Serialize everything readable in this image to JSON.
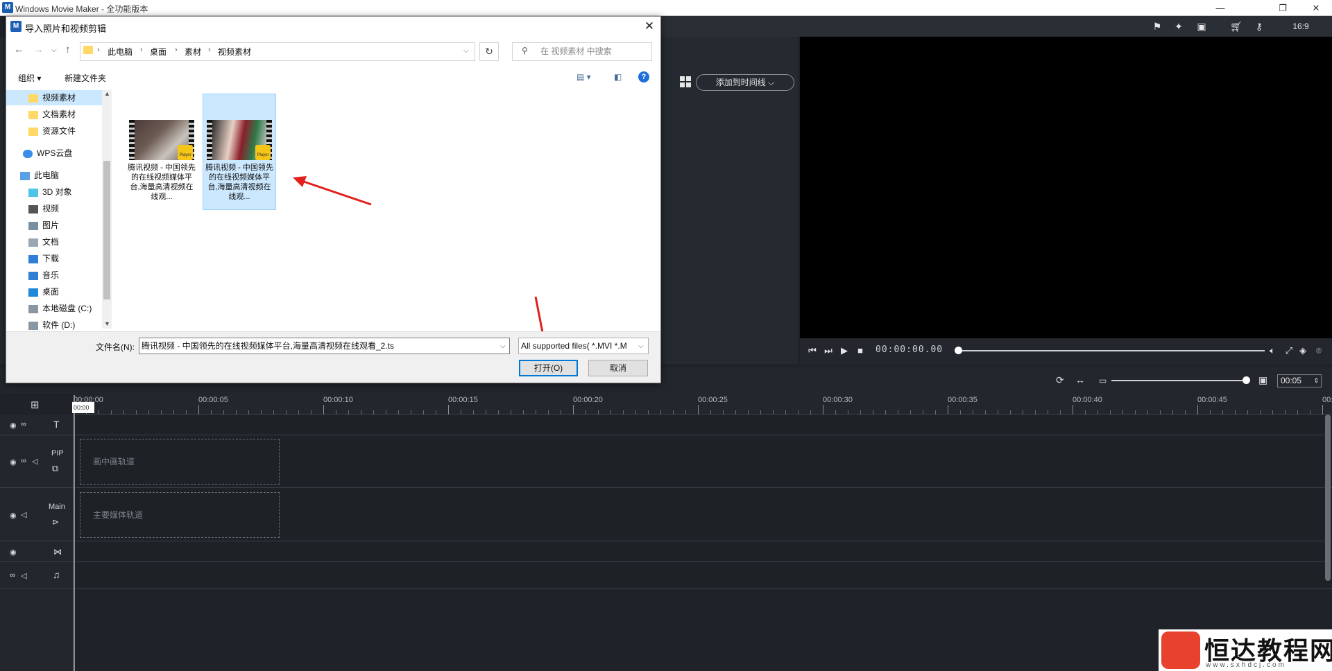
{
  "app": {
    "title": "Windows Movie Maker  - 全功能版本"
  },
  "media": {
    "add_to_timeline": "添加到时间线"
  },
  "preview": {
    "timecode": "00:00:00.00"
  },
  "timeline": {
    "duration": "00:05",
    "ticks": [
      "00:00:00",
      "00:00:05",
      "00:00:10",
      "00:00:15",
      "00:00:20",
      "00:00:25",
      "00:00:30",
      "00:00:35",
      "00:00:40",
      "00:00:45",
      "00:0"
    ],
    "playhead": "00:00",
    "tracks": {
      "pip_label": "PIP",
      "pip_drop": "画中画轨道",
      "main_label": "Main",
      "main_drop": "主要媒体轨道"
    }
  },
  "dialog": {
    "title": "导入照片和视频剪辑",
    "breadcrumb": [
      "此电脑",
      "桌面",
      "素材",
      "视频素材"
    ],
    "search_placeholder": "在 视频素材 中搜索",
    "organize": "组织 ▾",
    "new_folder": "新建文件夹",
    "nav": [
      "视频素材",
      "文档素材",
      "资源文件",
      "WPS云盘",
      "此电脑",
      "3D 对象",
      "视频",
      "图片",
      "文档",
      "下载",
      "音乐",
      "桌面",
      "本地磁盘 (C:)",
      "软件 (D:)"
    ],
    "files": [
      {
        "caption": "腾讯视频 - 中国领先的在线视频媒体平台,海量高清视频在线观..."
      },
      {
        "caption": "腾讯视频 - 中国领先的在线视频媒体平台,海量高清视频在线观..."
      }
    ],
    "badge": "Player",
    "filename_label": "文件名(N):",
    "filename_value": "腾讯视频 - 中国领先的在线视频媒体平台,海量高清视频在线观看_2.ts",
    "filetype": "All supported files( *.MVI *.M",
    "open": "打开(O)",
    "cancel": "取消"
  },
  "watermark": {
    "name": "恒达教程网",
    "url": "www.sxhdcj.com"
  }
}
